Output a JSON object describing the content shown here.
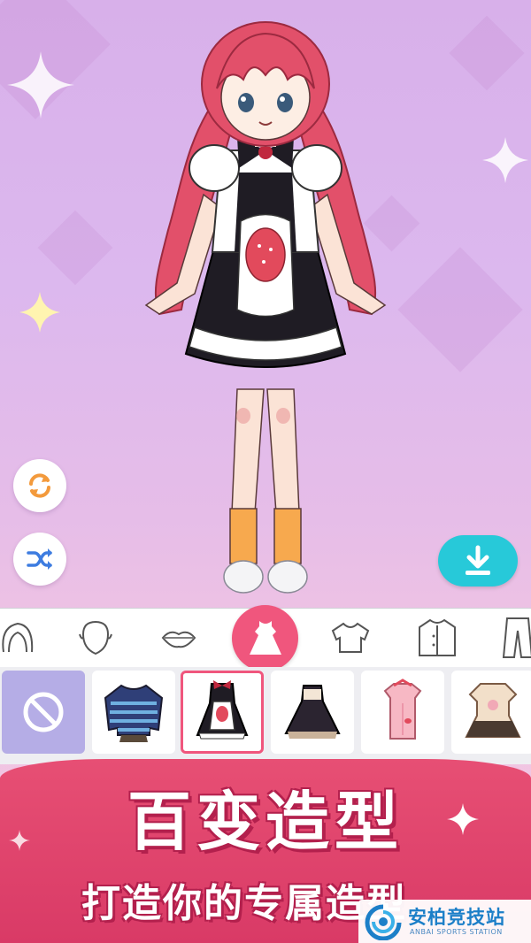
{
  "actions": {
    "reset_icon": "refresh-icon",
    "random_icon": "shuffle-icon",
    "download_icon": "download-icon"
  },
  "categories": [
    {
      "name": "hair-back",
      "icon": "hair-icon",
      "active": false
    },
    {
      "name": "face",
      "icon": "face-icon",
      "active": false
    },
    {
      "name": "mouth",
      "icon": "lips-icon",
      "active": false
    },
    {
      "name": "dress",
      "icon": "dress-icon",
      "active": true
    },
    {
      "name": "top",
      "icon": "shirt-icon",
      "active": false
    },
    {
      "name": "jacket",
      "icon": "jacket-icon",
      "active": false
    },
    {
      "name": "pants",
      "icon": "pants-icon",
      "active": false
    }
  ],
  "items": [
    {
      "name": "none",
      "icon": "no-icon"
    },
    {
      "name": "striped-sweater",
      "selected": false
    },
    {
      "name": "maid-dress",
      "selected": true
    },
    {
      "name": "black-gothic-dress",
      "selected": false
    },
    {
      "name": "pink-qipao-dress",
      "selected": false
    },
    {
      "name": "beige-bear-dress",
      "selected": false
    }
  ],
  "banner": {
    "title": "百变造型",
    "subtitle": "打造你的专属造型"
  },
  "watermark": {
    "name": "安柏竞技站",
    "sub": "ANBAI SPORTS STATION"
  },
  "colors": {
    "accent": "#f0567d",
    "download": "#27c9d9",
    "banner": "#e74f74",
    "icon_orange": "#f39a3c",
    "icon_blue": "#3d7ce0"
  }
}
